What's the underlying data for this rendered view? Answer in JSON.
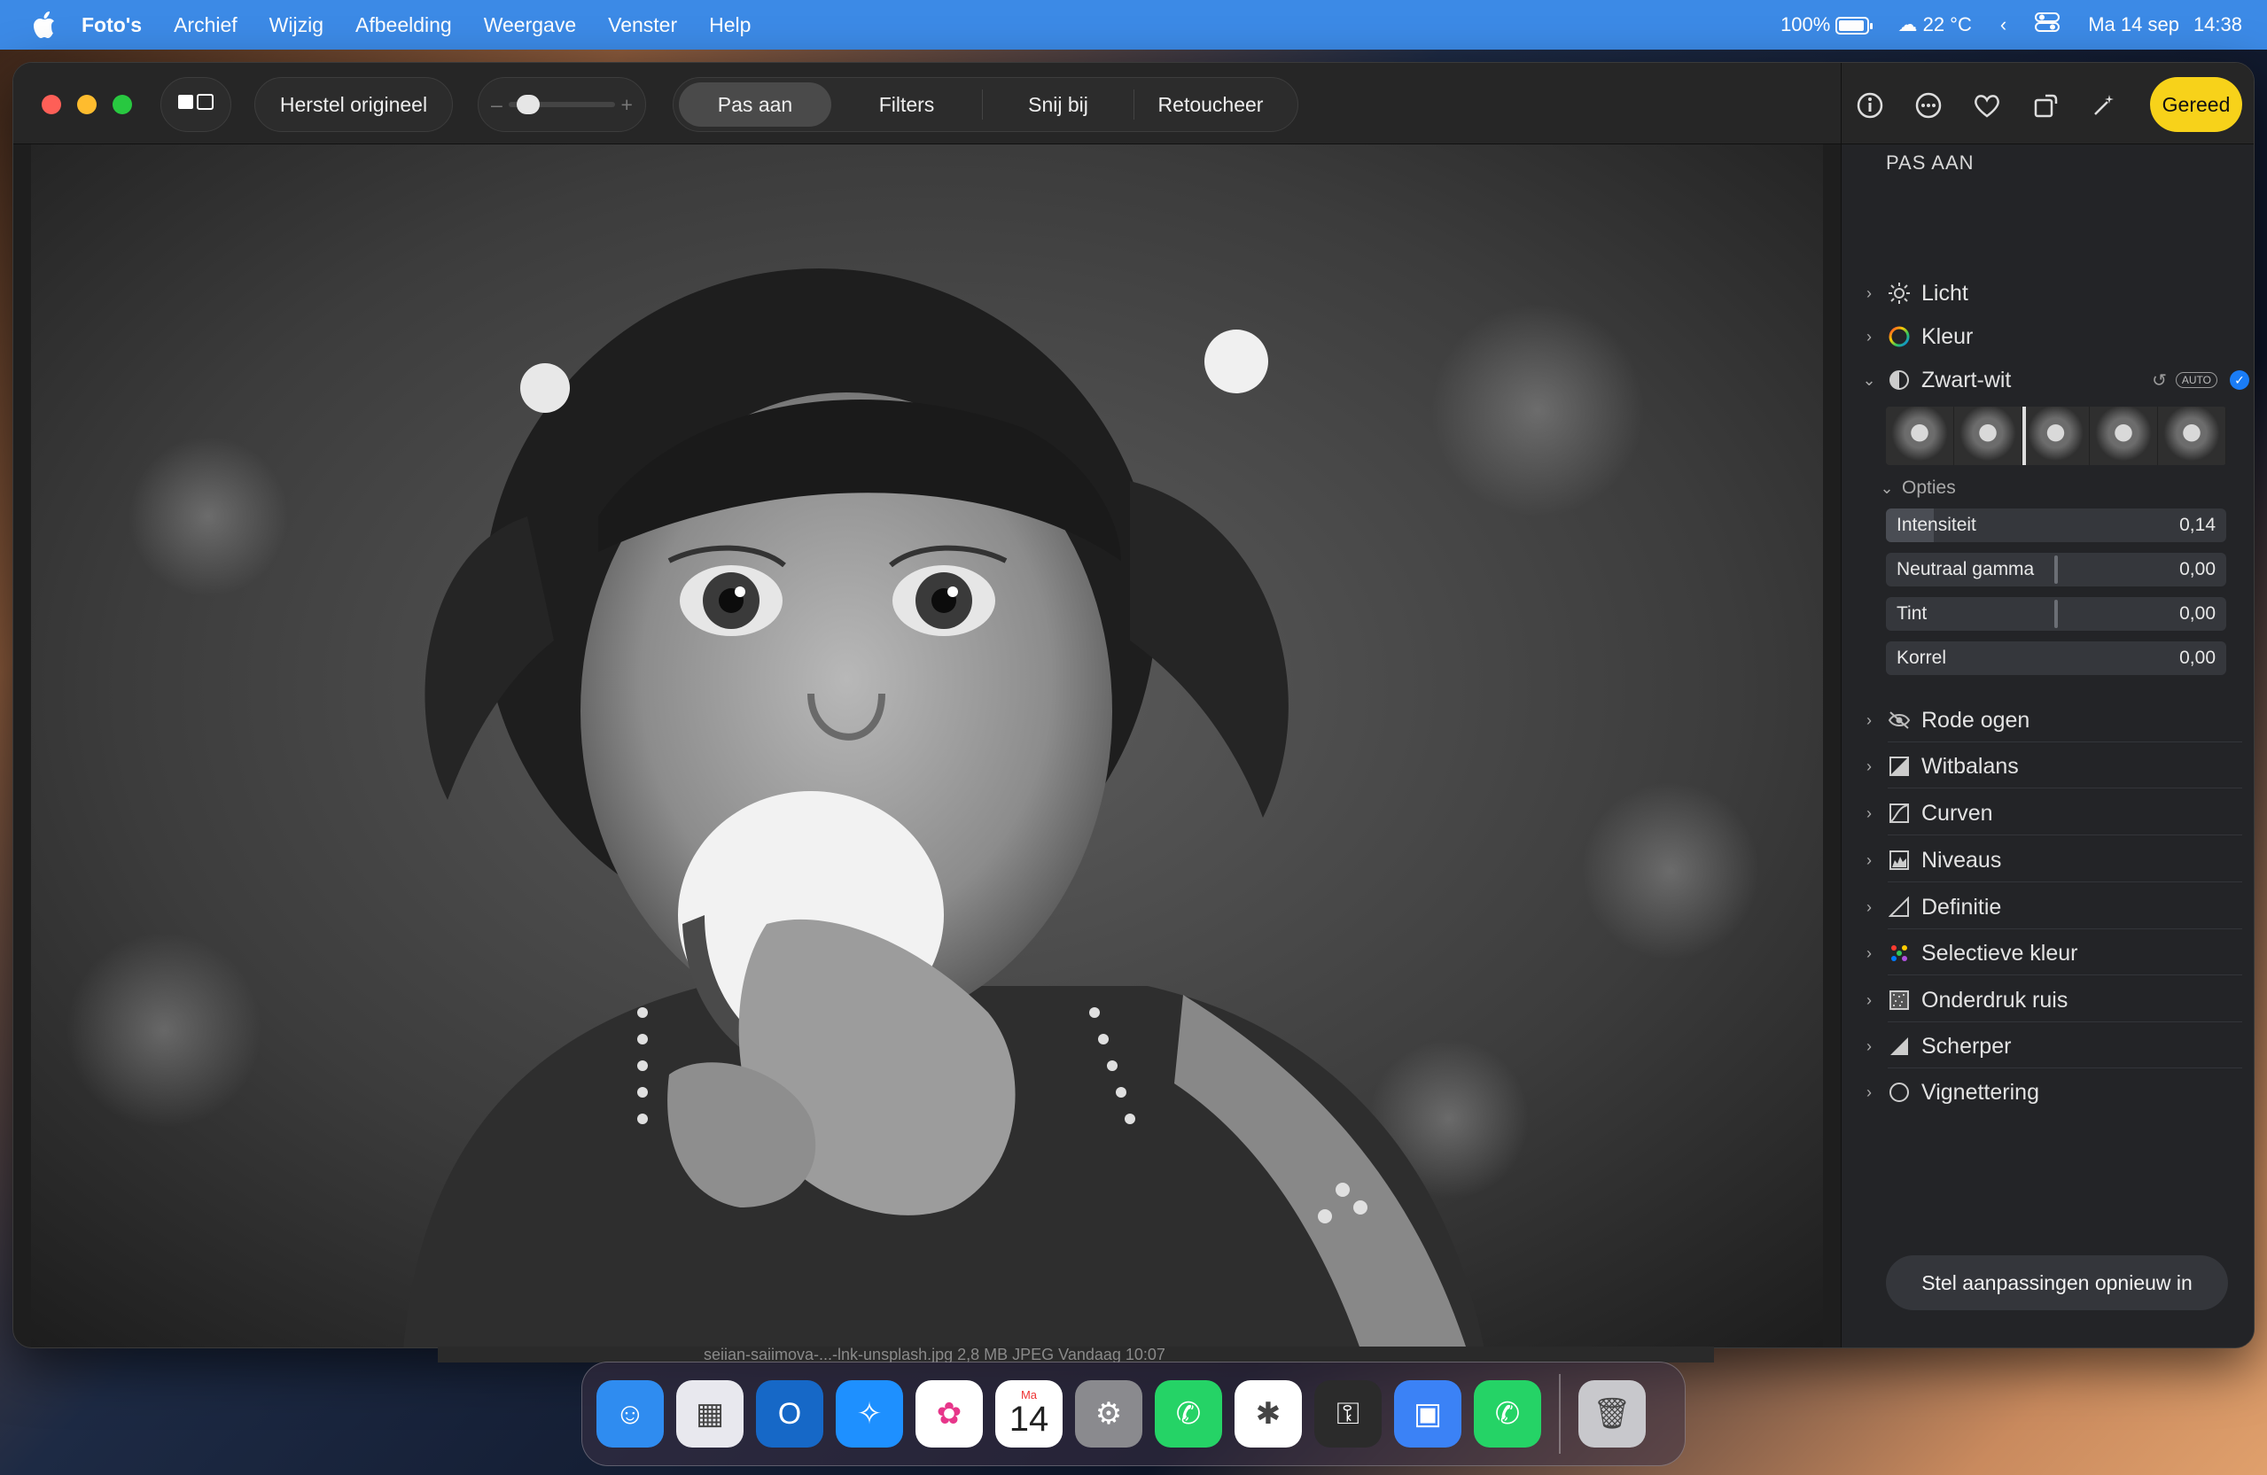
{
  "menubar": {
    "app_name": "Foto's",
    "menus": [
      "Archief",
      "Wijzig",
      "Afbeelding",
      "Weergave",
      "Venster",
      "Help"
    ],
    "battery": "100%",
    "weather": "22 °C",
    "date": "Ma 14 sep",
    "time": "14:38"
  },
  "toolbar": {
    "revert_label": "Herstel origineel",
    "zoom_minus": "–",
    "zoom_plus": "+",
    "zoom_level": 0.1,
    "tabs": [
      "Pas aan",
      "Filters",
      "Snij bij",
      "Retoucheer"
    ],
    "active_tab": "Pas aan",
    "done_label": "Gereed"
  },
  "panel": {
    "title": "PAS AAN",
    "top_items": [
      {
        "label": "Licht",
        "icon": "sun-icon"
      },
      {
        "label": "Kleur",
        "icon": "color-wheel-icon"
      },
      {
        "label": "Zwart-wit",
        "icon": "half-circle-icon",
        "expanded": true
      }
    ],
    "bw_auto": "AUTO",
    "options_label": "Opties",
    "sliders": [
      {
        "label": "Intensiteit",
        "value": "0,14",
        "level": 0.14
      },
      {
        "label": "Neutraal gamma",
        "value": "0,00",
        "level": 0.5
      },
      {
        "label": "Tint",
        "value": "0,00",
        "level": 0.5
      },
      {
        "label": "Korrel",
        "value": "0,00",
        "level": 0.0
      }
    ],
    "items": [
      {
        "label": "Rode ogen",
        "icon": "eye-icon"
      },
      {
        "label": "Witbalans",
        "icon": "white-balance-icon"
      },
      {
        "label": "Curven",
        "icon": "curves-icon"
      },
      {
        "label": "Niveaus",
        "icon": "levels-icon"
      },
      {
        "label": "Definitie",
        "icon": "definition-icon"
      },
      {
        "label": "Selectieve kleur",
        "icon": "selective-color-icon"
      },
      {
        "label": "Onderdruk ruis",
        "icon": "noise-icon"
      },
      {
        "label": "Scherper",
        "icon": "sharpen-icon"
      },
      {
        "label": "Vignettering",
        "icon": "vignette-icon"
      }
    ],
    "reset_label": "Stel aanpassingen opnieuw in"
  },
  "filebar": {
    "text": "seiian-saiimova-...-lnk-unsplash.jpg          2,8 MB    JPEG          Vandaag  10:07"
  },
  "dock": {
    "apps": [
      {
        "name": "finder",
        "color": "#2f8cf0"
      },
      {
        "name": "launchpad",
        "color": "#e8e8ee"
      },
      {
        "name": "outlook",
        "color": "#1668c7"
      },
      {
        "name": "safari",
        "color": "#1e90ff"
      },
      {
        "name": "photos",
        "color": "#ffffff"
      },
      {
        "name": "calendar",
        "color": "#ffffff",
        "month": "Ma",
        "day": "14"
      },
      {
        "name": "system-settings",
        "color": "#8a8a8e"
      },
      {
        "name": "whatsapp",
        "color": "#25d366"
      },
      {
        "name": "slack",
        "color": "#ffffff"
      },
      {
        "name": "keychain",
        "color": "#2b2b2b"
      },
      {
        "name": "terminal-app",
        "color": "#3b82f6"
      },
      {
        "name": "whatsapp-beta",
        "color": "#25d366"
      },
      {
        "name": "trash",
        "color": "#c8c8cc"
      }
    ]
  }
}
